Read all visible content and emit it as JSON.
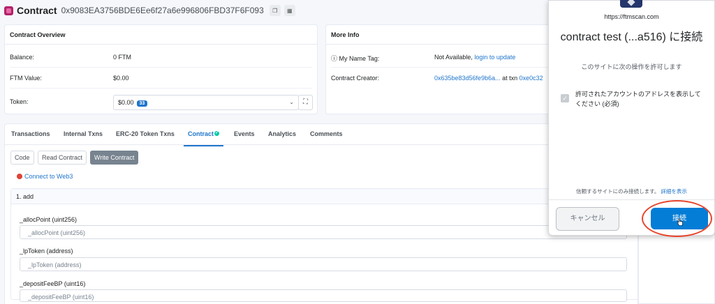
{
  "header": {
    "title": "Contract",
    "address": "0x9083EA3756BDE6Ee6f27a6e996806FBD37F6F093"
  },
  "overview": {
    "title": "Contract Overview",
    "balance_label": "Balance:",
    "balance_value": "0 FTM",
    "ftm_value_label": "FTM Value:",
    "ftm_value_value": "$0.00",
    "token_label": "Token:",
    "token_value": "$0.00",
    "token_count": "33"
  },
  "more_info": {
    "title": "More Info",
    "name_tag_label": "My Name Tag:",
    "name_tag_value": "Not Available,",
    "name_tag_link": "login to update",
    "creator_label": "Contract Creator:",
    "creator_address": "0x635be83d56fe9b6a...",
    "creator_at_txn": "at txn",
    "creator_txn": "0xe0c32"
  },
  "tabs": [
    "Transactions",
    "Internal Txns",
    "ERC-20 Token Txns",
    "Contract",
    "Events",
    "Analytics",
    "Comments"
  ],
  "subtabs": {
    "code": "Code",
    "read": "Read Contract",
    "write": "Write Contract"
  },
  "connect_web3": "Connect to Web3",
  "function": {
    "title": "1. add",
    "params": [
      {
        "label": "_allocPoint (uint256)",
        "placeholder": "_allocPoint (uint256)"
      },
      {
        "label": "_lpToken (address)",
        "placeholder": "_lpToken (address)"
      },
      {
        "label": "_depositFeeBP (uint16)",
        "placeholder": "_depositFeeBP (uint16)"
      }
    ]
  },
  "popup": {
    "site": "https://ftmscan.com",
    "title": "contract test (...a516) に接続",
    "subtitle": "このサイトに次の操作を許可します",
    "permission": "許可されたアカウントのアドレスを表示してください (必須)",
    "trust_text": "信頼するサイトにのみ接続します。",
    "details_link": "詳細を表示",
    "cancel_label": "キャンセル",
    "connect_label": "接続"
  },
  "colors": {
    "link": "#1f75cb",
    "connect": "#037dd6",
    "highlight": "#e8462d"
  }
}
